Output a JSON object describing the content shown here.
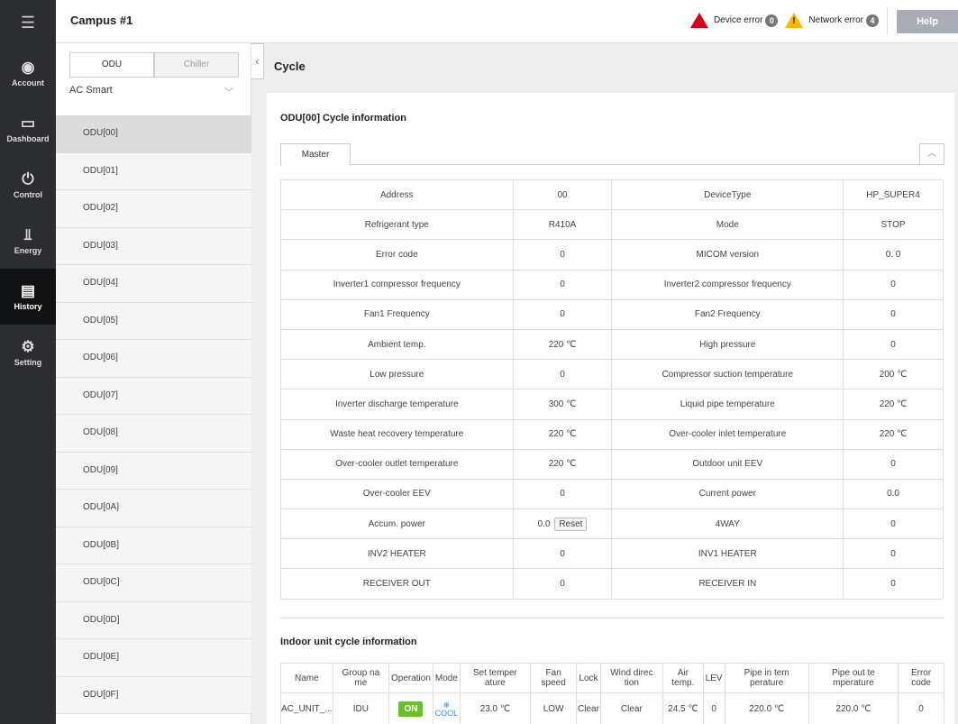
{
  "header": {
    "title": "Campus #1",
    "device_error_label": "Device error",
    "device_error_count": "0",
    "network_error_label": "Network error",
    "network_error_count": "4",
    "help_label": "Help"
  },
  "rail": {
    "items": [
      {
        "label": "Account",
        "icon": "account-icon"
      },
      {
        "label": "Dashboard",
        "icon": "dashboard-icon"
      },
      {
        "label": "Control",
        "icon": "control-icon"
      },
      {
        "label": "Energy",
        "icon": "energy-icon"
      },
      {
        "label": "History",
        "icon": "history-icon",
        "active": true
      },
      {
        "label": "Setting",
        "icon": "setting-icon"
      }
    ]
  },
  "list_panel": {
    "tab_odu": "ODU",
    "tab_chiller": "Chiller",
    "selector_value": "AC Smart",
    "items": [
      "ODU[00]",
      "ODU[01]",
      "ODU[02]",
      "ODU[03]",
      "ODU[04]",
      "ODU[05]",
      "ODU[06]",
      "ODU[07]",
      "ODU[08]",
      "ODU[09]",
      "ODU[0A]",
      "ODU[0B]",
      "ODU[0C]",
      "ODU[0D]",
      "ODU[0E]",
      "ODU[0F]"
    ]
  },
  "main": {
    "page_title": "Cycle",
    "section_title": "ODU[00] Cycle information",
    "subtab": "Master",
    "reset_label": "Reset",
    "rows": [
      [
        "Address",
        "00",
        "DeviceType",
        "HP_SUPER4"
      ],
      [
        "Refrigerant type",
        "R410A",
        "Mode",
        "STOP"
      ],
      [
        "Error code",
        "0",
        "MICOM version",
        "0. 0"
      ],
      [
        "Inverter1 compressor frequency",
        "0",
        "Inverter2 compressor frequency",
        "0"
      ],
      [
        "Fan1 Frequency",
        "0",
        "Fan2 Frequency",
        "0"
      ],
      [
        "Ambient temp.",
        "220 ℃",
        "High pressure",
        "0"
      ],
      [
        "Low pressure",
        "0",
        "Compressor suction temperature",
        "200 ℃"
      ],
      [
        "Inverter discharge temperature",
        "300 ℃",
        "Liquid pipe temperature",
        "220 ℃"
      ],
      [
        "Waste heat recovery temperature",
        "220 ℃",
        "Over-cooler inlet temperature",
        "220 ℃"
      ],
      [
        "Over-cooler outlet temperature",
        "220 ℃",
        "Outdoor unit EEV",
        "0"
      ],
      [
        "Over-cooler EEV",
        "0",
        "Current power",
        "0.0"
      ],
      [
        "Accum. power",
        "0.0",
        "4WAY",
        "0"
      ],
      [
        "INV2 HEATER",
        "0",
        "INV1 HEATER",
        "0"
      ],
      [
        "RECEIVER OUT",
        "0",
        "RECEIVER IN",
        "0"
      ]
    ],
    "indoor_title": "Indoor unit cycle information",
    "indoor_headers": [
      "Name",
      "Group na me",
      "Operation",
      "Mode",
      "Set temper ature",
      "Fan speed",
      "Lock",
      "Wind direc tion",
      "Air temp.",
      "LEV",
      "Pipe in tem perature",
      "Pipe out te mperature",
      "Error code"
    ],
    "indoor_rows": [
      {
        "name": "AC_UNIT_...",
        "group": "IDU",
        "operation": "ON",
        "mode": "COOL",
        "set_temp": "23.0 ℃",
        "fan": "LOW",
        "lock": "Clear",
        "wind": "Clear",
        "air": "24.5 ℃",
        "lev": "0",
        "pipe_in": "220.0 ℃",
        "pipe_out": "220.0 ℃",
        "error": "0"
      }
    ]
  }
}
